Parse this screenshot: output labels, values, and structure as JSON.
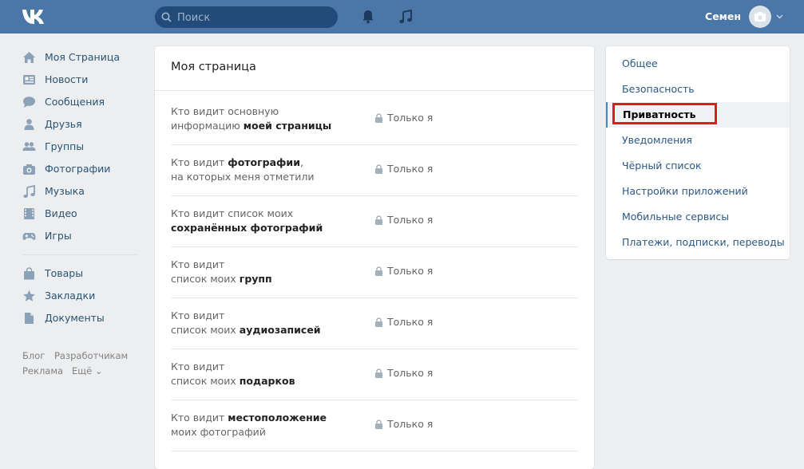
{
  "header": {
    "logo": "vk-logo",
    "search_placeholder": "Поиск",
    "user_name": "Семен"
  },
  "leftnav": {
    "items": [
      {
        "label": "Моя Страница",
        "icon": "home-icon"
      },
      {
        "label": "Новости",
        "icon": "news-icon"
      },
      {
        "label": "Сообщения",
        "icon": "messages-icon"
      },
      {
        "label": "Друзья",
        "icon": "friends-icon"
      },
      {
        "label": "Группы",
        "icon": "groups-icon"
      },
      {
        "label": "Фотографии",
        "icon": "camera-icon"
      },
      {
        "label": "Музыка",
        "icon": "music-icon"
      },
      {
        "label": "Видео",
        "icon": "video-icon"
      },
      {
        "label": "Игры",
        "icon": "gamepad-icon"
      },
      {
        "label": "Товары",
        "icon": "bag-icon"
      },
      {
        "label": "Закладки",
        "icon": "star-icon"
      },
      {
        "label": "Документы",
        "icon": "document-icon"
      }
    ],
    "footer": {
      "blog": "Блог",
      "developers": "Разработчикам",
      "ads": "Реклама",
      "more": "Ещё ⌄"
    }
  },
  "main": {
    "title": "Моя страница",
    "rows": [
      {
        "line1": "Кто видит основную",
        "line2_plain": "информацию ",
        "line2_bold": "моей страницы",
        "value": "Только я"
      },
      {
        "line1_plain": "Кто видит ",
        "line1_bold": "фотографии",
        "line1_tail": ",",
        "line2_plain": "на которых меня отметили",
        "value": "Только я"
      },
      {
        "line1": "Кто видит список моих",
        "line2_bold": "сохранённых фотографий",
        "value": "Только я"
      },
      {
        "line1": "Кто видит",
        "line2_plain": "список моих ",
        "line2_bold": "групп",
        "value": "Только я"
      },
      {
        "line1": "Кто видит",
        "line2_plain": "список моих ",
        "line2_bold": "аудиозаписей",
        "value": "Только я"
      },
      {
        "line1": "Кто видит",
        "line2_plain": "список моих ",
        "line2_bold": "подарков",
        "value": "Только я"
      },
      {
        "line1_plain": "Кто видит ",
        "line1_bold": "местоположение",
        "line2_plain": "моих фотографий",
        "value": "Только я"
      }
    ]
  },
  "rightmenu": {
    "items": [
      "Общее",
      "Безопасность",
      "Приватность",
      "Уведомления",
      "Чёрный список",
      "Настройки приложений",
      "Мобильные сервисы",
      "Платежи, подписки, переводы"
    ],
    "active": "Приватность"
  },
  "colors": {
    "header": "#4a76a8",
    "link": "#2a5885",
    "highlight": "#e01b23"
  }
}
